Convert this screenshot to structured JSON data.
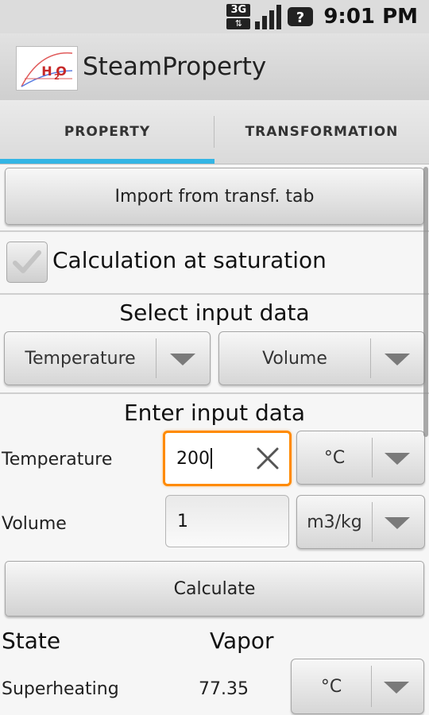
{
  "status_bar": {
    "network_type": "3G",
    "signal_icon": "signal-bars-icon",
    "notification_icon": "help-icon",
    "time": "9:01 PM"
  },
  "app": {
    "title": "SteamProperty",
    "icon_text": "H₂O"
  },
  "tabs": [
    {
      "label": "PROPERTY",
      "active": true
    },
    {
      "label": "TRANSFORMATION",
      "active": false
    }
  ],
  "colors": {
    "tab_indicator": "#33b5e5",
    "focus_border": "#ff8a00"
  },
  "import_button": {
    "label": "Import from transf. tab"
  },
  "saturation": {
    "label": "Calculation at saturation",
    "checked": false
  },
  "select_section": {
    "heading": "Select input data",
    "spinner1": {
      "selected": "Temperature"
    },
    "spinner2": {
      "selected": "Volume"
    }
  },
  "enter_section": {
    "heading": "Enter input data",
    "field1": {
      "label": "Temperature",
      "value": "200",
      "unit": "°C"
    },
    "field2": {
      "label": "Volume",
      "value": "1",
      "unit": "m3/kg"
    }
  },
  "calculate_button": {
    "label": "Calculate"
  },
  "result": {
    "state_label": "State",
    "state_value": "Vapor",
    "superheating_label": "Superheating",
    "superheating_value": "77.35",
    "superheating_unit": "°C"
  }
}
